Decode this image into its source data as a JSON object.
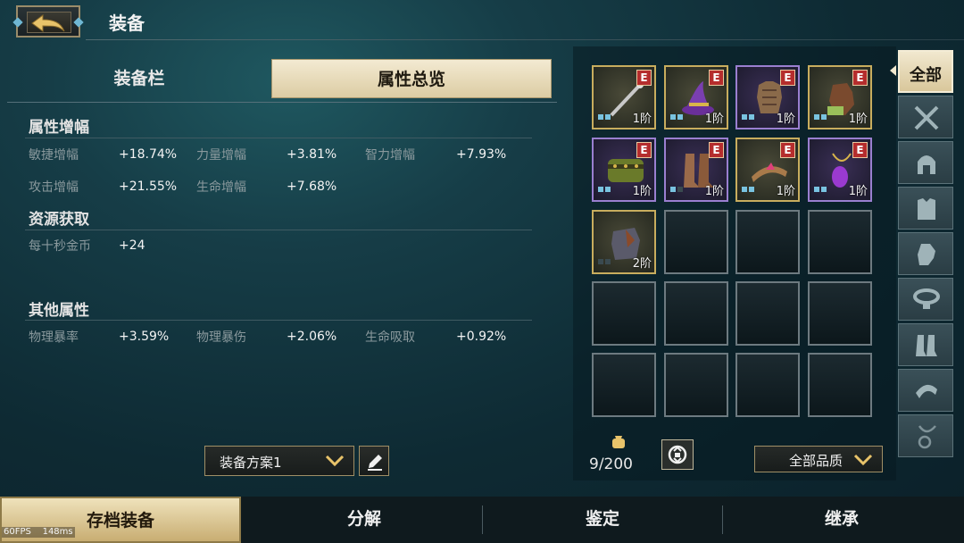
{
  "header": {
    "title": "装备"
  },
  "tabs": {
    "slots": "装备栏",
    "overview": "属性总览"
  },
  "sections": {
    "growth": {
      "title": "属性增幅",
      "rows": [
        [
          {
            "label": "敏捷增幅",
            "value": "+18.74%"
          },
          {
            "label": "力量增幅",
            "value": "+3.81%"
          },
          {
            "label": "智力增幅",
            "value": "+7.93%"
          }
        ],
        [
          {
            "label": "攻击增幅",
            "value": "+21.55%"
          },
          {
            "label": "生命增幅",
            "value": "+7.68%"
          }
        ]
      ]
    },
    "resource": {
      "title": "资源获取",
      "rows": [
        [
          {
            "label": "每十秒金币",
            "value": "+24"
          }
        ]
      ]
    },
    "other": {
      "title": "其他属性",
      "rows": [
        [
          {
            "label": "物理暴率",
            "value": "+3.59%"
          },
          {
            "label": "物理暴伤",
            "value": "+2.06%"
          },
          {
            "label": "生命吸取",
            "value": "+0.92%"
          }
        ]
      ]
    }
  },
  "plan": {
    "selected": "装备方案1"
  },
  "inventory": {
    "count": "9/200",
    "quality_filter": "全部品质",
    "items": [
      {
        "icon": "staff-icon",
        "rarity": "gold",
        "badge": "E",
        "tier": "1阶"
      },
      {
        "icon": "wizard-hat-icon",
        "rarity": "gold",
        "badge": "E",
        "tier": "1阶"
      },
      {
        "icon": "chest-armor-icon",
        "rarity": "purple",
        "badge": "E",
        "tier": "1阶"
      },
      {
        "icon": "gauntlet-icon",
        "rarity": "gold",
        "badge": "E",
        "tier": "1阶"
      },
      {
        "icon": "belt-icon",
        "rarity": "purple",
        "badge": "E",
        "tier": "1阶"
      },
      {
        "icon": "boots-icon",
        "rarity": "purple",
        "badge": "E",
        "tier": "1阶"
      },
      {
        "icon": "circlet-icon",
        "rarity": "gold",
        "badge": "E",
        "tier": "1阶"
      },
      {
        "icon": "amulet-icon",
        "rarity": "purple",
        "badge": "E",
        "tier": "1阶"
      },
      {
        "icon": "bracer-icon",
        "rarity": "gold",
        "badge": "",
        "tier": "2阶"
      }
    ]
  },
  "filters": {
    "all": "全部"
  },
  "bottom_tabs": {
    "save": "存档装备",
    "dismantle": "分解",
    "identify": "鉴定",
    "inherit": "继承"
  },
  "debug": {
    "fps": "60FPS",
    "latency": "148ms"
  }
}
